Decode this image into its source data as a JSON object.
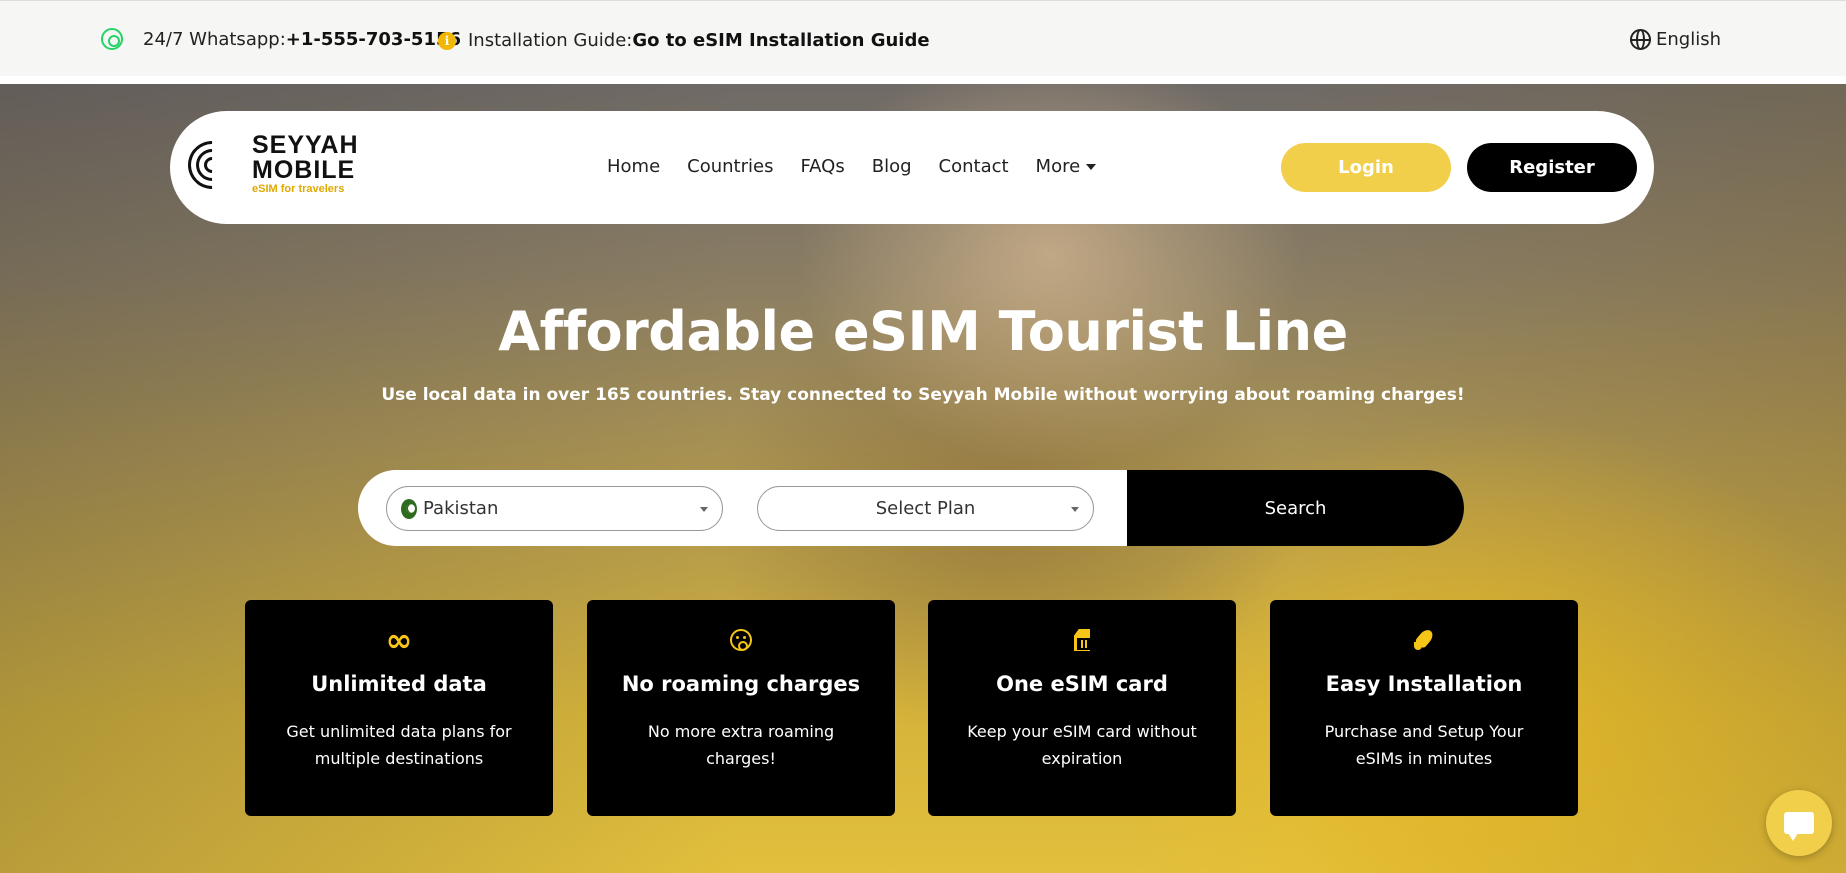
{
  "topbar": {
    "whatsapp_prefix": "24/7 Whatsapp: ",
    "whatsapp_number": "+1-555-703-5156",
    "guide_prefix": "Installation Guide: ",
    "guide_link": "Go to eSIM Installation Guide",
    "language": "English"
  },
  "brand": {
    "name_line1": "SEYYAH",
    "name_line2": "MOBILE",
    "tagline": "eSIM for travelers",
    "accent": "#f2cf4a"
  },
  "nav": {
    "items": [
      "Home",
      "Countries",
      "FAQs",
      "Blog",
      "Contact",
      "More"
    ],
    "login_label": "Login",
    "register_label": "Register"
  },
  "hero": {
    "title": "Affordable eSIM Tourist Line",
    "subtitle": "Use local data in over 165 countries. Stay connected to Seyyah Mobile without worrying about roaming charges!"
  },
  "search": {
    "country_value": "Pakistan",
    "plan_placeholder": "Select Plan",
    "button_label": "Search"
  },
  "features": [
    {
      "icon": "infinity-icon",
      "title": "Unlimited data",
      "desc": "Get unlimited data plans for multiple destinations"
    },
    {
      "icon": "surprised-face-icon",
      "title": "No roaming charges",
      "desc": "No more extra roaming charges!"
    },
    {
      "icon": "sim-card-icon",
      "title": "One eSIM card",
      "desc": "Keep your eSIM card without expiration"
    },
    {
      "icon": "rocket-icon",
      "title": "Easy Installation",
      "desc": "Purchase and Setup Your eSIMs in minutes"
    }
  ]
}
